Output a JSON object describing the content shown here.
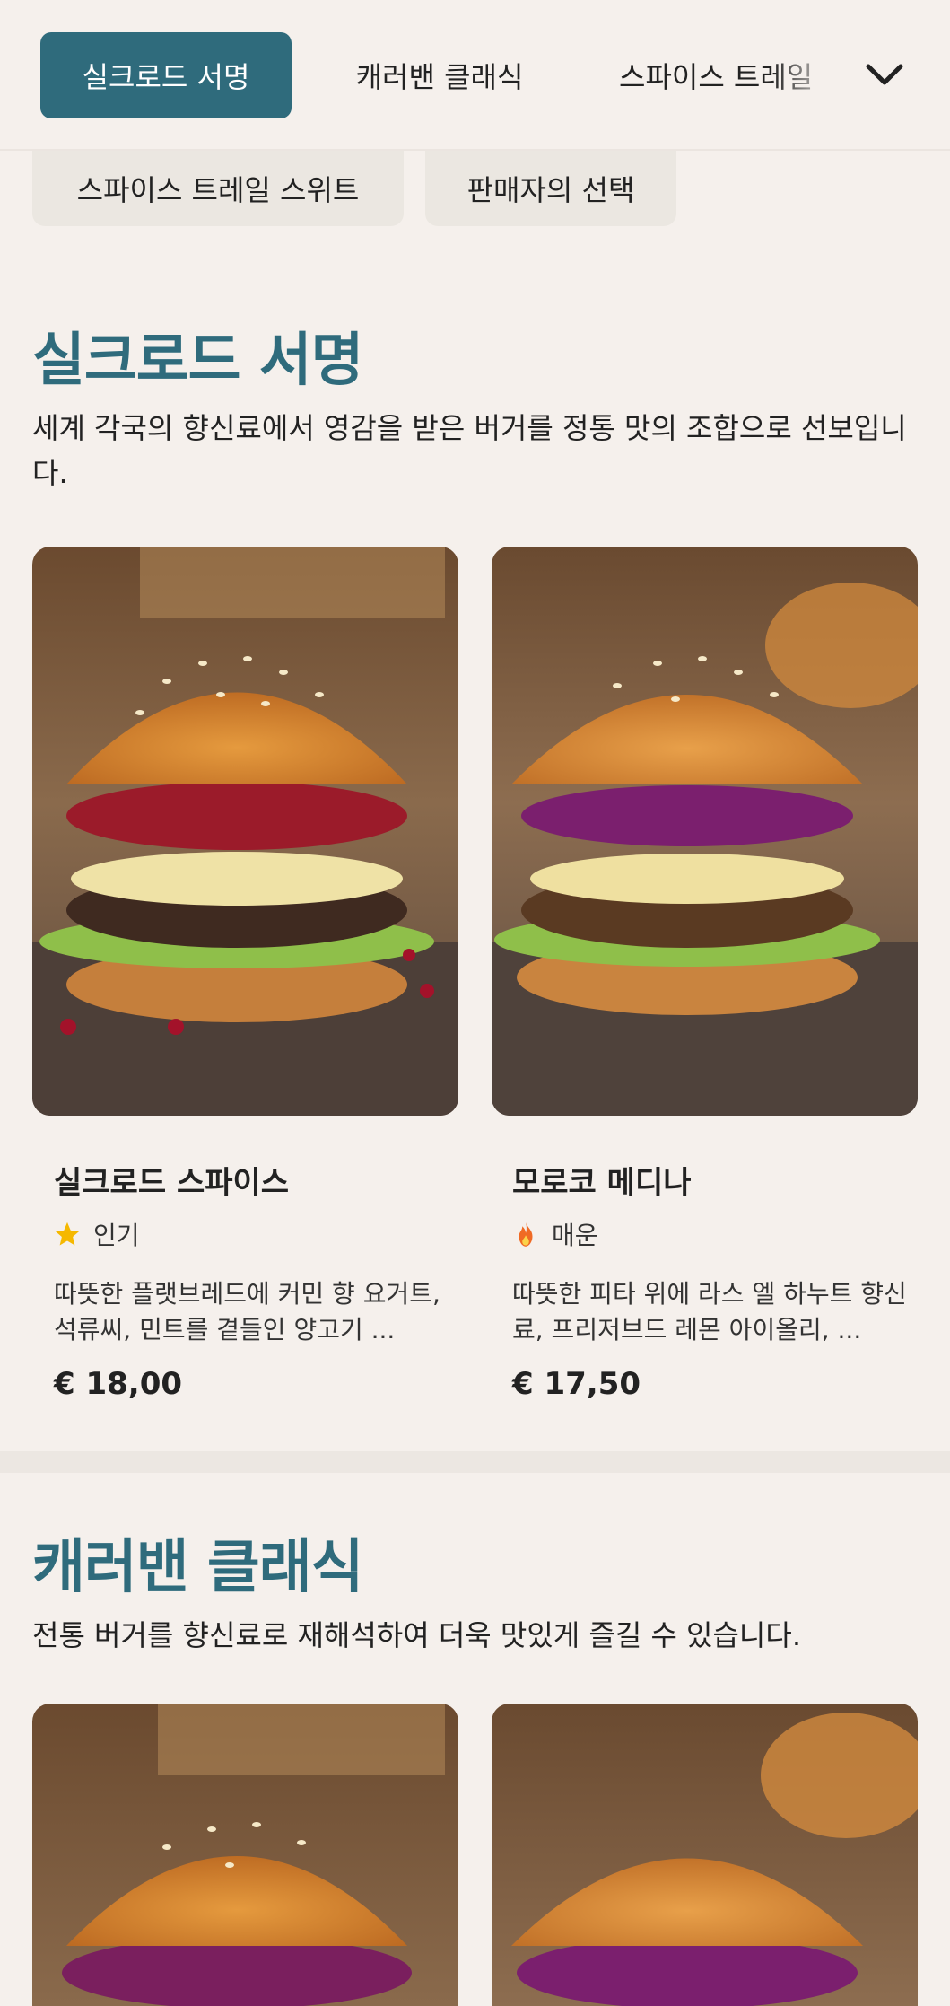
{
  "nav": {
    "tabs": [
      {
        "label": "실크로드 서명",
        "active": true
      },
      {
        "label": "캐러밴 클래식",
        "active": false
      },
      {
        "label": "스파이스 트레일",
        "active": false
      }
    ],
    "expand_icon": "chevron-down-icon"
  },
  "chips": [
    {
      "label": "스파이스 트레일 스위트"
    },
    {
      "label": "판매자의 선택"
    }
  ],
  "sections": [
    {
      "title": "실크로드 서명",
      "description": "세계 각국의 향신료에서 영감을 받은 버거를 정통 맛의 조합으로 선보입니다.",
      "items": [
        {
          "name": "실크로드 스파이스",
          "badge": {
            "icon": "star-icon",
            "label": "인기",
            "color": "#f5b800"
          },
          "description": "따뜻한 플랫브레드에 커민 향 요거트, 석류씨, 민트를 곁들인 양고기 ...",
          "price": "€ 18,00"
        },
        {
          "name": "모로코 메디나",
          "badge": {
            "icon": "flame-icon",
            "label": "매운",
            "color": "#f06a24"
          },
          "description": "따뜻한 피타 위에 라스 엘 하누트 향신료, 프리저브드 레몬 아이올리, ...",
          "price": "€ 17,50"
        }
      ]
    },
    {
      "title": "캐러밴 클래식",
      "description": "전통 버거를 향신료로 재해석하여 더욱 맛있게 즐길 수 있습니다."
    }
  ],
  "colors": {
    "accent": "#2f6b7c",
    "background": "#f5f0ec",
    "chip_background": "#ebe7e1"
  }
}
